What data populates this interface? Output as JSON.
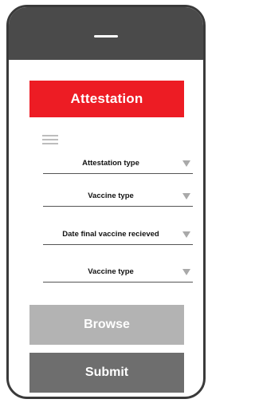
{
  "header": {
    "title": "Attestation",
    "color": "#ed1c24"
  },
  "menu": {
    "icon": "hamburger-menu-icon"
  },
  "form": {
    "fields": [
      {
        "label": "Attestation type",
        "icon": "dropdown-arrow-icon"
      },
      {
        "label": "Vaccine type",
        "icon": "dropdown-arrow-icon"
      },
      {
        "label": "Date final vaccine recieved",
        "icon": "dropdown-arrow-icon"
      },
      {
        "label": "Vaccine type",
        "icon": "dropdown-arrow-icon"
      }
    ]
  },
  "actions": {
    "browse_label": "Browse",
    "browse_color": "#b3b3b3",
    "submit_label": "Submit",
    "submit_color": "#6e6e6e"
  }
}
